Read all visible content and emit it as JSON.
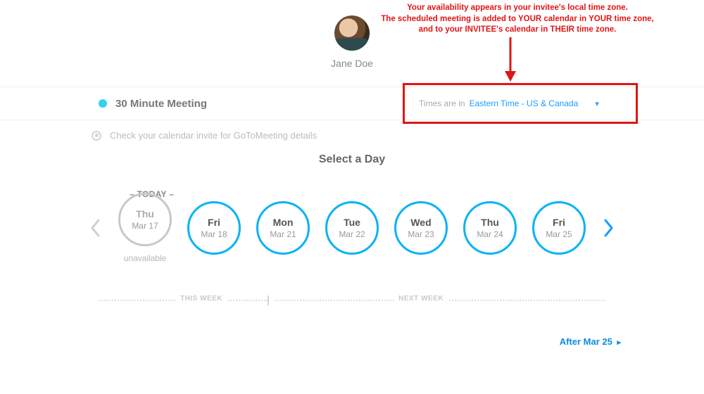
{
  "profile": {
    "name": "Jane Doe"
  },
  "annotation": {
    "line1": "Your availability appears in your invitee's local time zone.",
    "line2": "The scheduled meeting is added to YOUR calendar in YOUR time zone,",
    "line3": "and to your INVITEE's calendar in THEIR time zone."
  },
  "header": {
    "meeting_title": "30 Minute Meeting",
    "tz_label": "Times are in",
    "tz_value": "Eastern Time - US & Canada"
  },
  "subnote": {
    "text": "Check your calendar invite for GoToMeeting details"
  },
  "select_day_title": "Select a Day",
  "today_label": "– TODAY –",
  "days": [
    {
      "weekday": "Thu",
      "date": "Mar 17",
      "unavailable_label": "unavailable"
    },
    {
      "weekday": "Fri",
      "date": "Mar 18"
    },
    {
      "weekday": "Mon",
      "date": "Mar 21"
    },
    {
      "weekday": "Tue",
      "date": "Mar 22"
    },
    {
      "weekday": "Wed",
      "date": "Mar 23"
    },
    {
      "weekday": "Thu",
      "date": "Mar 24"
    },
    {
      "weekday": "Fri",
      "date": "Mar 25"
    }
  ],
  "week_labels": {
    "this_week": "THIS WEEK",
    "next_week": "NEXT WEEK"
  },
  "after_link": {
    "label": "After Mar 25"
  }
}
